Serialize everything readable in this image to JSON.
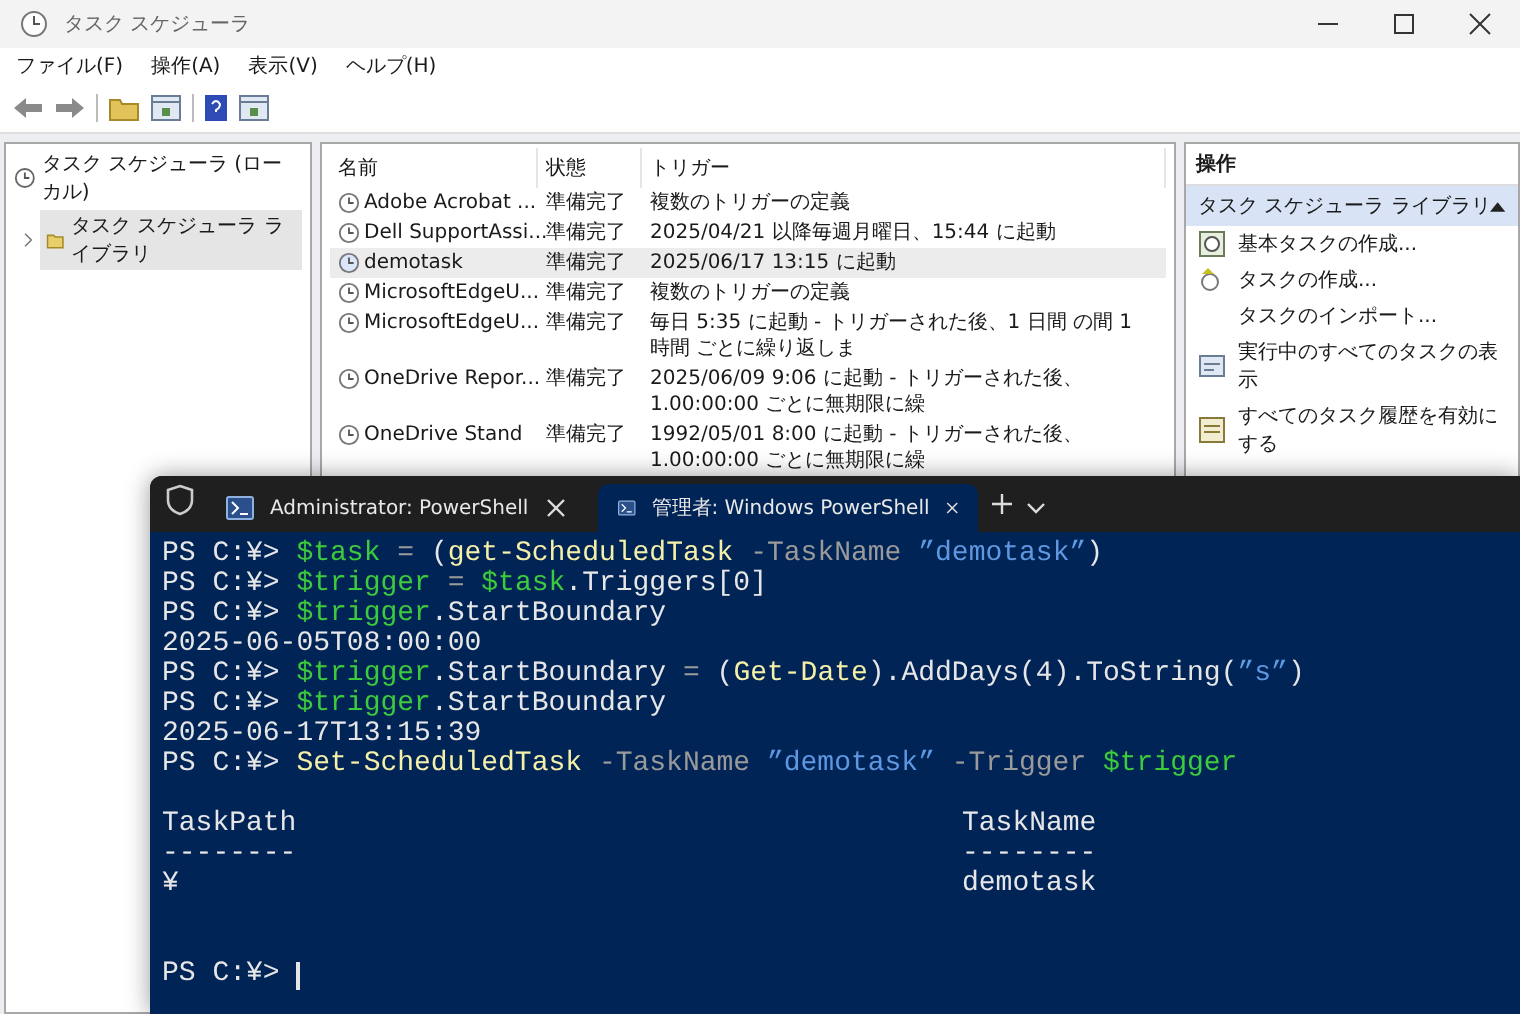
{
  "window": {
    "title": "タスク スケジューラ"
  },
  "menu": [
    "ファイル(F)",
    "操作(A)",
    "表示(V)",
    "ヘルプ(H)"
  ],
  "tree": [
    {
      "label": "タスク スケジューラ (ローカル)",
      "selected": false,
      "children": [
        {
          "label": "タスク スケジューラ ライブラリ",
          "expanded": false,
          "selected": true
        }
      ]
    }
  ],
  "task_list": {
    "columns": [
      "名前",
      "状態",
      "トリガー"
    ],
    "rows": [
      {
        "name": "Adobe Acrobat ...",
        "status": "準備完了",
        "trigger": "複数のトリガーの定義",
        "selected": false
      },
      {
        "name": "Dell SupportAssi...",
        "status": "準備完了",
        "trigger": "2025/04/21 以降毎週月曜日、15:44 に起動",
        "selected": false
      },
      {
        "name": "demotask",
        "status": "準備完了",
        "trigger": "2025/06/17 13:15 に起動",
        "selected": true
      },
      {
        "name": "MicrosoftEdgeU...",
        "status": "準備完了",
        "trigger": "複数のトリガーの定義",
        "selected": false
      },
      {
        "name": "MicrosoftEdgeU...",
        "status": "準備完了",
        "trigger": "毎日 5:35 に起動 - トリガーされた後、1 日間 の間 1 時間 ごとに繰り返しま",
        "selected": false
      },
      {
        "name": "OneDrive Repor...",
        "status": "準備完了",
        "trigger": "2025/06/09 9:06 に起動 - トリガーされた後、1.00:00:00 ごとに無期限に繰",
        "selected": false
      },
      {
        "name": "OneDrive Stand",
        "status": "準備完了",
        "trigger": "1992/05/01 8:00 に起動 - トリガーされた後、1.00:00:00 ごとに無期限に繰",
        "selected": false
      }
    ]
  },
  "actions": {
    "title": "操作",
    "group": {
      "label": "タスク スケジューラ ライブラリ",
      "expanded": true
    },
    "items": [
      {
        "label": "基本タスクの作成...",
        "kind": "basic"
      },
      {
        "label": "タスクの作成...",
        "kind": "task"
      },
      {
        "label": "タスクのインポート...",
        "kind": "plain"
      },
      {
        "label": "実行中のすべてのタスクの表示",
        "kind": "running"
      },
      {
        "label": "すべてのタスク履歴を有効にする",
        "kind": "history"
      }
    ]
  },
  "terminal": {
    "tabs": [
      {
        "title": "Administrator: PowerShell",
        "selected": false
      },
      {
        "title": "管理者: Windows PowerShell",
        "selected": true
      }
    ],
    "lines": [
      [
        {
          "text": "PS C:¥> ",
          "kind": "plain"
        },
        {
          "text": "$task",
          "kind": "variable"
        },
        {
          "text": " = ",
          "kind": "operator"
        },
        {
          "text": "(",
          "kind": "plain"
        },
        {
          "text": "get-ScheduledTask",
          "kind": "command"
        },
        {
          "text": " -TaskName ",
          "kind": "parameter"
        },
        {
          "text": "”demotask”",
          "kind": "string"
        },
        {
          "text": ")",
          "kind": "plain"
        }
      ],
      [
        {
          "text": "PS C:¥> ",
          "kind": "plain"
        },
        {
          "text": "$trigger",
          "kind": "variable"
        },
        {
          "text": " = ",
          "kind": "operator"
        },
        {
          "text": "$task",
          "kind": "variable"
        },
        {
          "text": ".Triggers[0]",
          "kind": "plain"
        }
      ],
      [
        {
          "text": "PS C:¥> ",
          "kind": "plain"
        },
        {
          "text": "$trigger",
          "kind": "variable"
        },
        {
          "text": ".StartBoundary",
          "kind": "plain"
        }
      ],
      [
        {
          "text": "2025-06-05T08:00:00",
          "kind": "plain"
        }
      ],
      [
        {
          "text": "PS C:¥> ",
          "kind": "plain"
        },
        {
          "text": "$trigger",
          "kind": "variable"
        },
        {
          "text": ".StartBoundary",
          "kind": "plain"
        },
        {
          "text": " = ",
          "kind": "operator"
        },
        {
          "text": "(",
          "kind": "plain"
        },
        {
          "text": "Get-Date",
          "kind": "command"
        },
        {
          "text": ").AddDays(4).ToString(",
          "kind": "plain"
        },
        {
          "text": "”s”",
          "kind": "string"
        },
        {
          "text": ")",
          "kind": "plain"
        }
      ],
      [
        {
          "text": "PS C:¥> ",
          "kind": "plain"
        },
        {
          "text": "$trigger",
          "kind": "variable"
        },
        {
          "text": ".StartBoundary",
          "kind": "plain"
        }
      ],
      [
        {
          "text": "2025-06-17T13:15:39",
          "kind": "plain"
        }
      ],
      [
        {
          "text": "PS C:¥> ",
          "kind": "plain"
        },
        {
          "text": "Set-ScheduledTask",
          "kind": "command"
        },
        {
          "text": " -TaskName ",
          "kind": "parameter"
        },
        {
          "text": "”demotask”",
          "kind": "string"
        },
        {
          "text": " -Trigger ",
          "kind": "parameter"
        },
        {
          "text": "$trigger",
          "kind": "variable"
        }
      ]
    ],
    "output_table": [
      {
        "header": "TaskPath",
        "rule": "--------",
        "value": "¥"
      },
      {
        "header": "TaskName",
        "rule": "--------",
        "value": "demotask"
      }
    ],
    "prompt": "PS C:¥> "
  }
}
